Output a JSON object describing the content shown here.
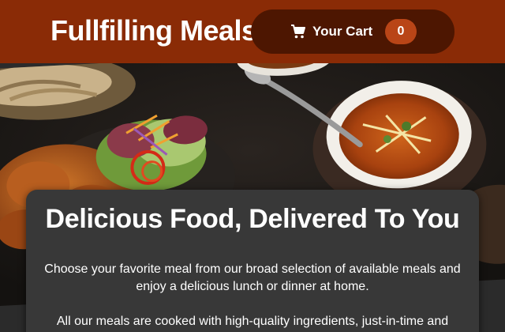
{
  "header": {
    "brand": "Fullfilling Meals",
    "cart": {
      "label": "Your Cart",
      "count": "0",
      "icon": "cart-icon"
    }
  },
  "colors": {
    "header_bg": "#8a2b06",
    "cart_button_bg": "#4d1601",
    "badge_bg": "#b94517",
    "card_bg": "#383838",
    "page_bg": "#2b2b2b"
  },
  "summary": {
    "title": "Delicious Food, Delivered To You",
    "paragraph_1": "Choose your favorite meal from our broad selection of available meals and enjoy a delicious lunch or dinner at home.",
    "paragraph_2": "All our meals are cooked with high-quality ingredients, just-in-time and"
  }
}
